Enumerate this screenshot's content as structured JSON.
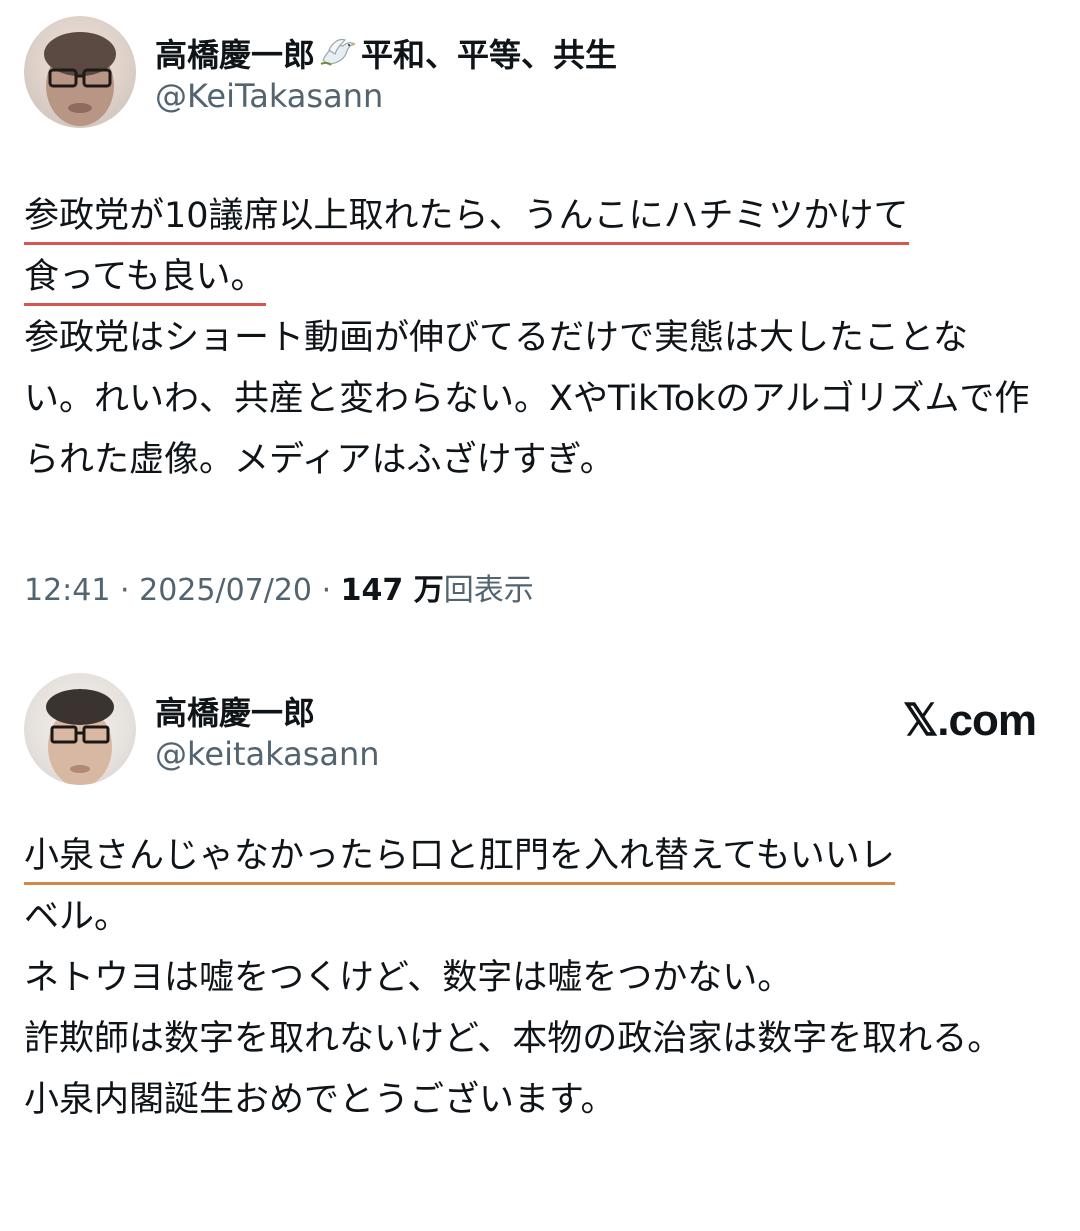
{
  "tweet1": {
    "display_name": "高橋慶一郎",
    "name_suffix": "平和、平等、共生",
    "name_icon": "dove-icon",
    "handle": "@KeiTakasann",
    "highlight_line1": "参政党が10議席以上取れたら、うんこにハチミツかけて",
    "highlight_line2": "食っても良い。",
    "body_rest": "参政党はショート動画が伸びてるだけで実態は大したことない。れいわ、共産と変わらない。XやTikTokのアルゴリズムで作られた虚像。メディアはふざけすぎ。",
    "time": "12:41",
    "date": "2025/07/20",
    "views_count": "147 万",
    "views_label": "回表示",
    "separator": "·"
  },
  "tweet2": {
    "display_name": "高橋慶一郎",
    "handle": "@keitakasann",
    "source_label": "𝕏.com",
    "highlight_line1": "小泉さんじゃなかったら口と肛門を入れ替えてもいいレ",
    "body_rest": "ベル。\nネトウヨは嘘をつくけど、数字は嘘をつかない。\n詐欺師は数字を取れないけど、本物の政治家は数字を取れる。\n小泉内閣誕生おめでとうございます。"
  },
  "colors": {
    "text": "#0f1419",
    "secondary": "#536471",
    "underline_red": "#d9534f",
    "underline_orange": "#d0894a"
  }
}
